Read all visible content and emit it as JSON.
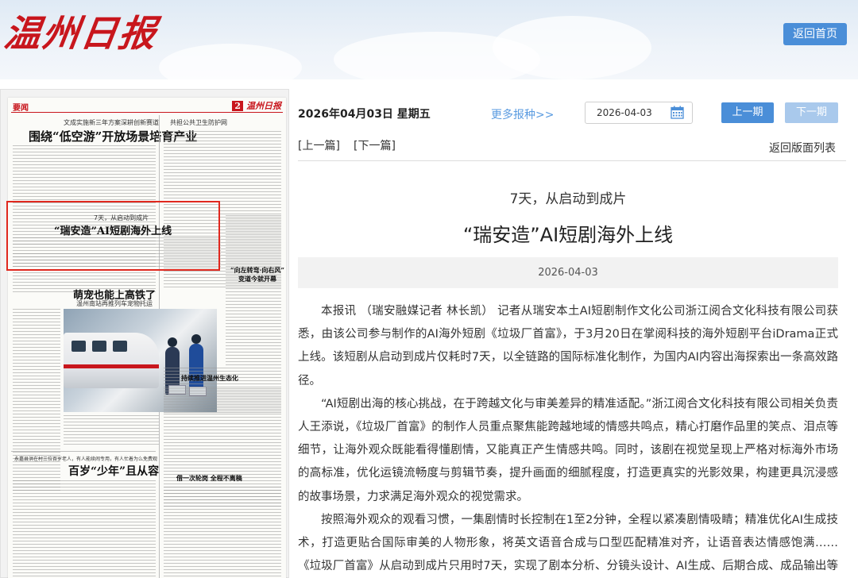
{
  "header": {
    "logo_text": "温州日报",
    "home_button": "返回首页"
  },
  "paper_page": {
    "section": "要闻",
    "masthead": "温州日报",
    "page_no": "2",
    "kicker_1": "文成实施新三年方案深耕创新赛道",
    "headline_1": "围绕“低空游”开放场景培育产业",
    "kicker_2": "7天，从启动到成片",
    "headline_2": "“瑞安造”AI短剧海外上线",
    "right_headline_1": "共担公共卫生防护网",
    "right_headline_2": "“向左转弯·向右风”\n变道今就开幕",
    "headline_3": "萌宠也能上高铁了",
    "kicker_3": "温州南站再推列车宠物托运",
    "right_headline_3": "持续推进温州生态化",
    "kicker_4": "永嘉县洪在村三位百岁老人，有人能续闹专用，有人忙着为么免费观，有人尽量能讲究——",
    "headline_4": "百岁“少年”且从容",
    "right_headline_4": "借一次轮岗  全程不离稿"
  },
  "toolbar": {
    "date_title": "2026年04月03日 星期五",
    "more_papers": "更多报种>>",
    "date_value": "2026-04-03",
    "prev_issue": "上一期",
    "next_issue": "下一期"
  },
  "nav": {
    "prev_article": "[上一篇]",
    "next_article": "[下一篇]",
    "back_to_list": "返回版面列表"
  },
  "article": {
    "subtitle": "7天，从启动到成片",
    "title": "“瑞安造”AI短剧海外上线",
    "date": "2026-04-03",
    "paragraphs": [
      "本报讯 （瑞安融媒记者 林长凯） 记者从瑞安本土AI短剧制作文化公司浙江阅合文化科技有限公司获悉，由该公司参与制作的AI海外短剧《垃圾厂首富》，于3月20日在掌阅科技的海外短剧平台iDrama正式上线。该短剧从启动到成片仅耗时7天，以全链路的国际标准化制作，为国内AI内容出海探索出一条高效路径。",
      "“AI短剧出海的核心挑战，在于跨越文化与审美差异的精准适配。”浙江阅合文化科技有限公司相关负责人王添说，《垃圾厂首富》的制作人员重点聚焦能跨越地域的情感共鸣点，精心打磨作品里的笑点、泪点等细节，让海外观众既能看得懂剧情，又能真正产生情感共鸣。同时，该剧在视觉呈现上严格对标海外市场的高标准，优化运镜流畅度与剪辑节奏，提升画面的细腻程度，打造更真实的光影效果，构建更具沉浸感的故事场景，力求满足海外观众的视觉需求。",
      "按照海外观众的观看习惯，一集剧情时长控制在1至2分钟，全程以紧凑剧情吸睛；精准优化AI生成技术，打造更贴合国际审美的人物形象，将英文语音合成与口型匹配精准对齐，让语音表达情感饱满……《垃圾厂首富》从启动到成片只用时7天，实现了剧本分析、分镜头设计、AI生成、后期合成、成品输出等整个流程AI制作全链路高度同步与高效流转。"
    ]
  },
  "colors": {
    "brand_red": "#c8161d",
    "primary_blue": "#4a8ed8",
    "disabled_blue": "#a9c9ec",
    "link_blue": "#5a9be0"
  }
}
